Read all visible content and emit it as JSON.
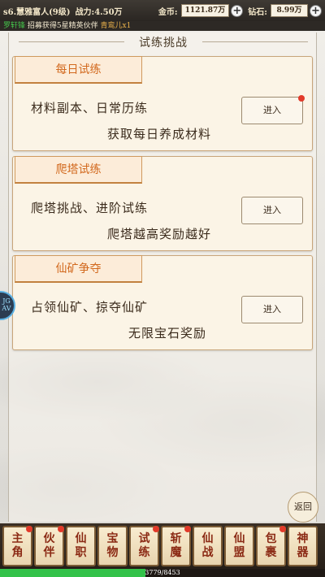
{
  "topbar": {
    "player": "s6.慧雅富人(9级)",
    "power": "战力:4.50万",
    "gold_label": "金币:",
    "gold_value": "1121.87万",
    "gem_label": "钻石:",
    "gem_value": "8.99万",
    "plus": "+"
  },
  "ticker": {
    "name": "罗轩锋",
    "msg": "招募获得5星精英伙伴",
    "partner": "青鸾儿x1"
  },
  "panel": {
    "title": "试练挑战"
  },
  "cards": [
    {
      "tab": "每日试练",
      "line1": "材料副本、日常历练",
      "line2": "获取每日养成材料",
      "button": "进入",
      "has_dot": true
    },
    {
      "tab": "爬塔试练",
      "line1": "爬塔挑战、进阶试练",
      "line2": "爬塔越高奖励越好",
      "button": "进入",
      "has_dot": false
    },
    {
      "tab": "仙矿争夺",
      "line1": "占领仙矿、掠夺仙矿",
      "line2": "无限宝石奖励",
      "button": "进入",
      "has_dot": false
    }
  ],
  "side_badge": "JG\nAV",
  "return_label": "返回",
  "nav": [
    {
      "label1": "主",
      "label2": "角",
      "dot": true
    },
    {
      "label1": "伙",
      "label2": "伴",
      "dot": true
    },
    {
      "label1": "仙",
      "label2": "职",
      "dot": false
    },
    {
      "label1": "宝",
      "label2": "物",
      "dot": false
    },
    {
      "label1": "试",
      "label2": "练",
      "dot": true
    },
    {
      "label1": "斩",
      "label2": "魔",
      "dot": true
    },
    {
      "label1": "仙",
      "label2": "战",
      "dot": false
    },
    {
      "label1": "仙",
      "label2": "盟",
      "dot": false
    },
    {
      "label1": "包",
      "label2": "裹",
      "dot": true
    },
    {
      "label1": "神",
      "label2": "器",
      "dot": false
    }
  ],
  "exp": {
    "text": "3779/8453",
    "fraction": 0.447
  },
  "colors": {
    "accent": "#d2691e",
    "exp": "#33c24a",
    "dot": "#e23a2a"
  }
}
